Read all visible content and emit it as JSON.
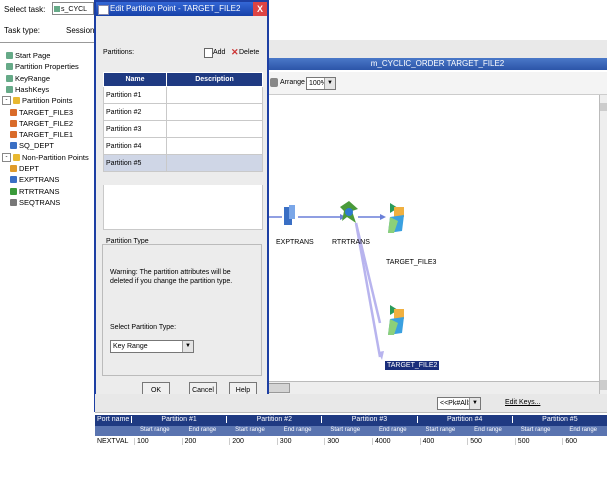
{
  "topbar": {
    "select_task_label": "Select task:",
    "select_task_value": "s_CYCL",
    "task_type_label": "Task type:",
    "task_type_value": "Session"
  },
  "tree": {
    "items": [
      {
        "label": "Start Page",
        "icon": "page-icon",
        "color": "#6a8"
      },
      {
        "label": "Partition Properties",
        "icon": "page-icon",
        "color": "#6a8"
      },
      {
        "label": "KeyRange",
        "icon": "page-icon",
        "color": "#6a8"
      },
      {
        "label": "HashKeys",
        "icon": "page-icon",
        "color": "#6a8"
      },
      {
        "label": "Partition Points",
        "icon": "folder-icon",
        "color": "#e8b830",
        "expander": "-"
      },
      {
        "label": "TARGET_FILE3",
        "icon": "target-icon",
        "color": "#d96b2a"
      },
      {
        "label": "TARGET_FILE2",
        "icon": "target-icon",
        "color": "#d96b2a"
      },
      {
        "label": "TARGET_FILE1",
        "icon": "target-icon",
        "color": "#d96b2a"
      },
      {
        "label": "SQ_DEPT",
        "icon": "source-qualifier-icon",
        "color": "#3a6fc4"
      },
      {
        "label": "Non-Partition Points",
        "icon": "folder-icon",
        "color": "#e8b830",
        "expander": "-"
      },
      {
        "label": "DEPT",
        "icon": "source-icon",
        "color": "#e09b2a"
      },
      {
        "label": "EXPTRANS",
        "icon": "expression-icon",
        "color": "#3a6fc4"
      },
      {
        "label": "RTRTRANS",
        "icon": "router-icon",
        "color": "#3a9a3a"
      },
      {
        "label": "SEQTRANS",
        "icon": "sequence-icon",
        "color": "#777"
      }
    ]
  },
  "dialog": {
    "title": "Edit Partition Point - TARGET_FILE2",
    "close_label": "X",
    "partitions_label": "Partitions:",
    "add_label": "Add",
    "delete_label": "Delete",
    "columns": [
      "Name",
      "Description"
    ],
    "rows": [
      {
        "name": "Partition #1",
        "description": ""
      },
      {
        "name": "Partition #2",
        "description": ""
      },
      {
        "name": "Partition #3",
        "description": ""
      },
      {
        "name": "Partition #4",
        "description": ""
      },
      {
        "name": "Partition #5",
        "description": ""
      }
    ],
    "selected_row": 4,
    "partition_type_group": "Partition Type",
    "warning_text": "Warning: The partition attributes will be deleted if you change the partition type.",
    "select_type_label": "Select Partition Type:",
    "select_type_value": "Key Range",
    "ok_label": "OK",
    "cancel_label": "Cancel",
    "help_label": "Help"
  },
  "mapping": {
    "title": "m_CYCLIC_ORDER TARGET_FILE2",
    "arrange_label": "Arrange",
    "zoom_value": "100%",
    "nodes": [
      {
        "label": "EXPTRANS"
      },
      {
        "label": "RTRTRANS"
      },
      {
        "label": "TARGET_FILE3"
      },
      {
        "label": "TARGET_FILE2"
      }
    ]
  },
  "grid": {
    "key_select_value": "<<Pk#All>>",
    "edit_keys_label": "Edit Keys...",
    "part_name_header": "Port name",
    "partitions": [
      "Partition #1",
      "Partition #2",
      "Partition #3",
      "Partition #4",
      "Partition #5"
    ],
    "sub_headers": [
      "Start range",
      "End range"
    ],
    "row": {
      "port": "NEXTVAL",
      "values": [
        "100",
        "200",
        "200",
        "300",
        "300",
        "4000",
        "400",
        "500",
        "500",
        "600"
      ]
    }
  }
}
